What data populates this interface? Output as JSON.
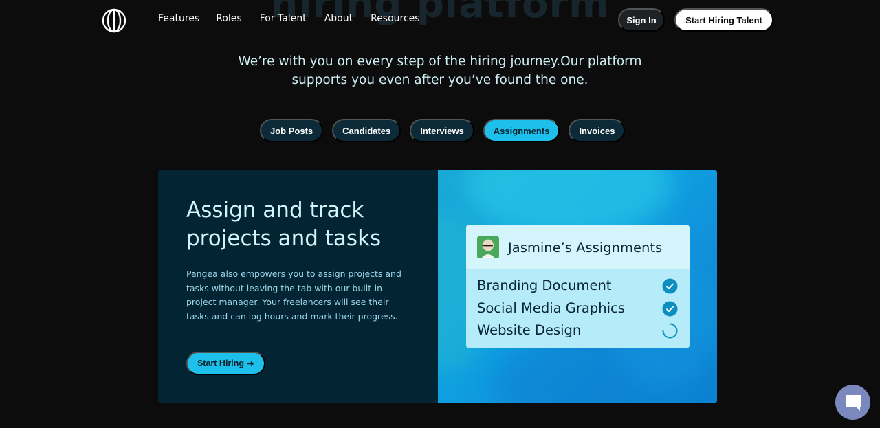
{
  "background_headline": "hiring platform",
  "nav": {
    "logo_icon": "pangea-globe-logo",
    "links": [
      "Features",
      "Roles",
      "For Talent",
      "About",
      "Resources"
    ],
    "sign_in": "Sign In",
    "cta": "Start Hiring Talent"
  },
  "hero": {
    "subtitle_line1": "We’re with you on every step of the hiring journey.Our platform",
    "subtitle_line2": "supports you even after you’ve found the one."
  },
  "tabs": [
    {
      "label": "Job Posts",
      "active": false
    },
    {
      "label": "Candidates",
      "active": false
    },
    {
      "label": "Interviews",
      "active": false
    },
    {
      "label": "Assignments",
      "active": true
    },
    {
      "label": "Invoices",
      "active": false
    }
  ],
  "feature": {
    "title_line1": "Assign and track",
    "title_line2": "projects and tasks",
    "description": "Pangea also empowers you to assign projects and tasks without leaving the tab with our built-in project manager. Your freelancers will see their tasks and can log hours and mark their progress.",
    "button_label": "Start Hiring",
    "button_icon": "arrow-right-icon"
  },
  "assignments": {
    "title": "Jasmine’s Assignments",
    "items": [
      {
        "label": "Branding Document",
        "status": "done"
      },
      {
        "label": "Social Media Graphics",
        "status": "done"
      },
      {
        "label": "Website Design",
        "status": "in-progress"
      }
    ]
  },
  "colors": {
    "accent": "#1cc0ea",
    "card_dark": "#032433",
    "page_bg": "#0c0c0c",
    "check": "#0a8fc0",
    "chat_bubble": "#7b88bd"
  },
  "chat": {
    "icon": "chat-bubble-icon"
  }
}
